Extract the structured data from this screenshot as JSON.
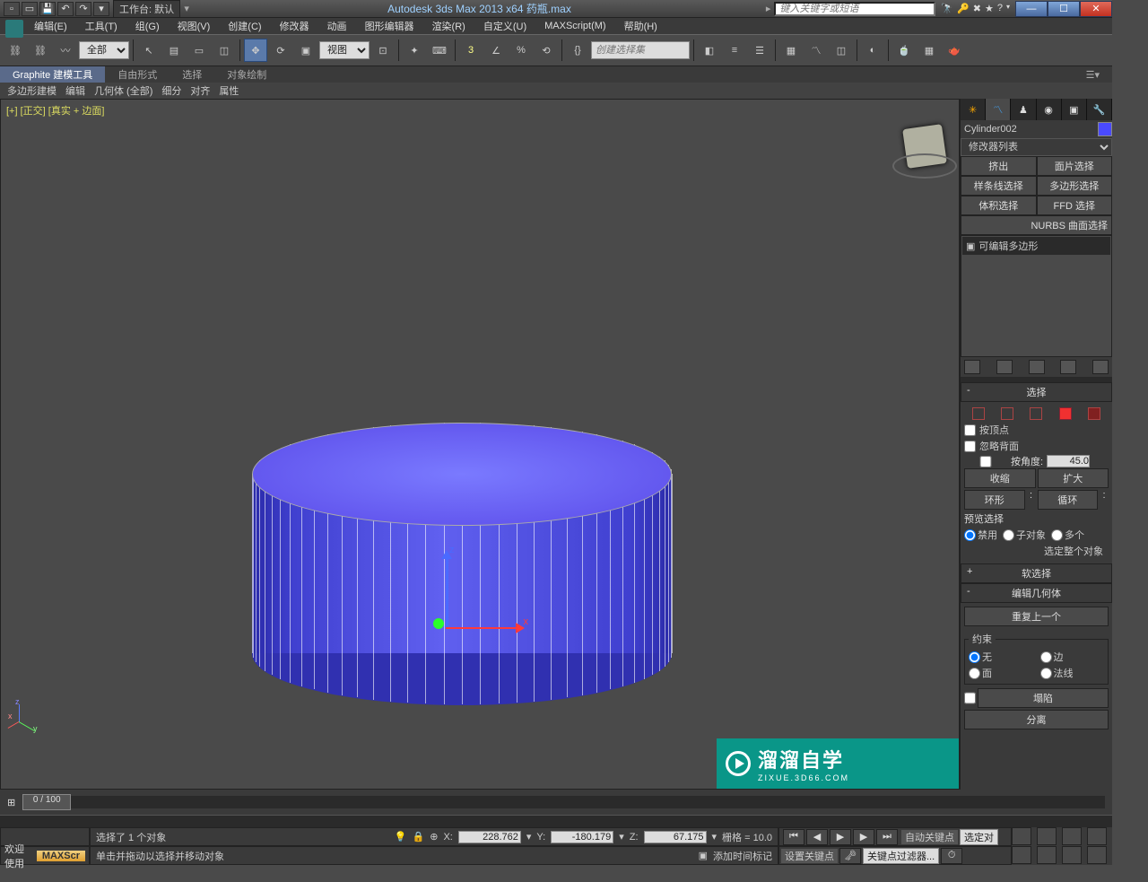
{
  "titlebar": {
    "workspace": "工作台: 默认",
    "title": "Autodesk 3ds Max  2013 x64     药瓶.max",
    "search_placeholder": "键入关键字或短语"
  },
  "menu": [
    "编辑(E)",
    "工具(T)",
    "组(G)",
    "视图(V)",
    "创建(C)",
    "修改器",
    "动画",
    "图形编辑器",
    "渲染(R)",
    "自定义(U)",
    "MAXScript(M)",
    "帮助(H)"
  ],
  "maintb": {
    "filter": "全部",
    "coord": "视图",
    "namedset_placeholder": "创建选择集"
  },
  "ribbon": {
    "tabs": [
      "Graphite 建模工具",
      "自由形式",
      "选择",
      "对象绘制"
    ],
    "sub": [
      "多边形建模",
      "编辑",
      "几何体 (全部)",
      "细分",
      "对齐",
      "属性"
    ]
  },
  "viewport": {
    "label": "[+] [正交] [真实 + 边面]"
  },
  "cmdpanel": {
    "objname": "Cylinder002",
    "modlist": "修改器列表",
    "presets": [
      "挤出",
      "面片选择",
      "样条线选择",
      "多边形选择",
      "体积选择",
      "FFD 选择"
    ],
    "nurbs": "NURBS 曲面选择",
    "stack_item": "可编辑多边形",
    "roll_select": "选择",
    "byvertex": "按顶点",
    "ignoreback": "忽略背面",
    "byangle": "按角度:",
    "angle_val": "45.0",
    "shrink": "收缩",
    "grow": "扩大",
    "ring": "环形",
    "loop": "循环",
    "preview": "预览选择",
    "preview_opts": [
      "禁用",
      "子对象",
      "多个"
    ],
    "selwhole": "选定整个对象",
    "roll_soft": "软选择",
    "roll_editgeo": "编辑几何体",
    "repeat": "重复上一个",
    "constraint": "约束",
    "cons_opts": [
      "无",
      "边",
      "面",
      "法线"
    ],
    "collapse": "塌陷",
    "detach": "分离"
  },
  "timeline": {
    "frames": "0 / 100"
  },
  "status": {
    "welcome": "欢迎使用",
    "max": "MAXScr",
    "sel": "选择了 1 个对象",
    "hint": "单击并拖动以选择并移动对象",
    "x": "228.762",
    "y": "-180.179",
    "z": "67.175",
    "grid": "栅格 = 10.0",
    "addtime": "添加时间标记",
    "autokey": "自动关键点",
    "setkey": "设置关键点",
    "selset": "选定对",
    "keyfilter": "关键点过滤器..."
  },
  "watermark": {
    "big": "溜溜自学",
    "url": "ZIXUE.3D66.COM"
  }
}
